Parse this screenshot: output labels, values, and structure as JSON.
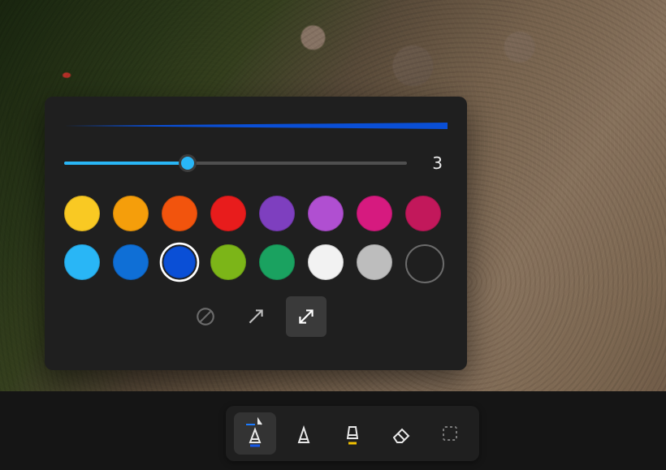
{
  "panel": {
    "preview_color": "#0a4fd6",
    "slider": {
      "value": 3,
      "min": 1,
      "max": 10,
      "fill_pct": 36,
      "thumb_pct": 36
    },
    "colors": [
      {
        "name": "yellow",
        "hex": "#f9c923",
        "selected": false
      },
      {
        "name": "orange",
        "hex": "#f59e0b",
        "selected": false
      },
      {
        "name": "deep-orange",
        "hex": "#f2540d",
        "selected": false
      },
      {
        "name": "red",
        "hex": "#e81c1c",
        "selected": false
      },
      {
        "name": "violet",
        "hex": "#7e3fbf",
        "selected": false
      },
      {
        "name": "purple",
        "hex": "#b04fd1",
        "selected": false
      },
      {
        "name": "magenta",
        "hex": "#d61a7f",
        "selected": false
      },
      {
        "name": "crimson",
        "hex": "#c2185b",
        "selected": false
      },
      {
        "name": "sky",
        "hex": "#29b6f6",
        "selected": false
      },
      {
        "name": "azure",
        "hex": "#0f6fd6",
        "selected": false
      },
      {
        "name": "blue",
        "hex": "#0a4fd6",
        "selected": true
      },
      {
        "name": "lime",
        "hex": "#7cb518",
        "selected": false
      },
      {
        "name": "green",
        "hex": "#1aa260",
        "selected": false
      },
      {
        "name": "white",
        "hex": "#f2f2f2",
        "selected": false
      },
      {
        "name": "grey",
        "hex": "#bdbdbd",
        "selected": false
      },
      {
        "name": "none",
        "hex": "",
        "selected": false
      }
    ],
    "tips": [
      {
        "name": "no-arrow",
        "active": false
      },
      {
        "name": "single-arrow",
        "active": false
      },
      {
        "name": "double-arrow",
        "active": true
      }
    ]
  },
  "toolbar": {
    "tools": [
      {
        "name": "pen",
        "accent": "#1357e8",
        "active": true,
        "has_settings_chevron": true
      },
      {
        "name": "pencil",
        "accent": "",
        "active": false,
        "has_settings_chevron": false
      },
      {
        "name": "highlighter",
        "accent": "#f2c200",
        "active": false,
        "has_settings_chevron": false
      },
      {
        "name": "eraser",
        "accent": "",
        "active": false,
        "has_settings_chevron": false
      },
      {
        "name": "crop",
        "accent": "",
        "active": false,
        "has_settings_chevron": false
      }
    ]
  }
}
